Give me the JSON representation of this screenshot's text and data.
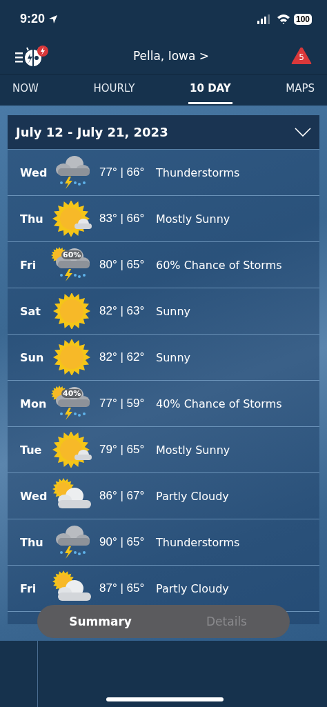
{
  "status_bar": {
    "time": "9:20",
    "battery": "100"
  },
  "header": {
    "location": "Pella, Iowa",
    "chevron": ">",
    "alert_count": "5"
  },
  "tabs": [
    {
      "label": "NOW",
      "selected": false
    },
    {
      "label": "HOURLY",
      "selected": false
    },
    {
      "label": "10 DAY",
      "selected": true
    },
    {
      "label": "MAPS",
      "selected": false
    }
  ],
  "range": {
    "label": "July 12 - July 21, 2023",
    "expanded": false
  },
  "days": [
    {
      "day": "Wed",
      "kind": "storm",
      "temps": "77° | 66°",
      "condition": "Thunderstorms"
    },
    {
      "day": "Thu",
      "kind": "mostly-sunny",
      "temps": "83° | 66°",
      "condition": "Mostly Sunny"
    },
    {
      "day": "Fri",
      "kind": "chance-storm",
      "icon_label": "60%",
      "temps": "80° | 65°",
      "condition": "60% Chance of Storms"
    },
    {
      "day": "Sat",
      "kind": "sunny",
      "temps": "82° | 63°",
      "condition": "Sunny"
    },
    {
      "day": "Sun",
      "kind": "sunny",
      "temps": "82° | 62°",
      "condition": "Sunny"
    },
    {
      "day": "Mon",
      "kind": "chance-storm",
      "icon_label": "40%",
      "temps": "77° | 59°",
      "condition": "40% Chance of Storms"
    },
    {
      "day": "Tue",
      "kind": "mostly-sunny",
      "temps": "79° | 65°",
      "condition": "Mostly Sunny"
    },
    {
      "day": "Wed",
      "kind": "partly-cloudy",
      "temps": "86° | 67°",
      "condition": "Partly Cloudy"
    },
    {
      "day": "Thu",
      "kind": "storm",
      "temps": "90° | 65°",
      "condition": "Thunderstorms"
    },
    {
      "day": "Fri",
      "kind": "partly-cloudy",
      "temps": "87° | 65°",
      "condition": "Partly Cloudy"
    }
  ],
  "view_switch": [
    {
      "label": "Summary",
      "selected": true
    },
    {
      "label": "Details",
      "selected": false
    }
  ]
}
